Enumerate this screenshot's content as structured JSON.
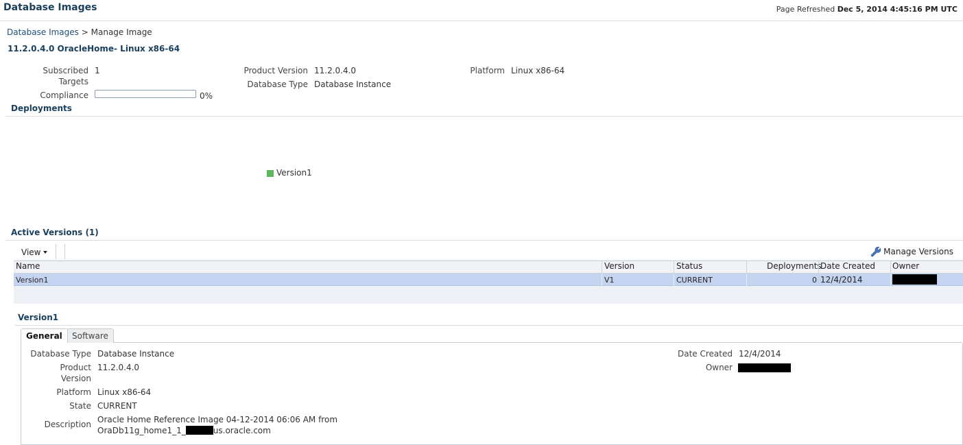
{
  "header": {
    "title": "Database Images",
    "refresh_label": "Page Refreshed",
    "refresh_time": "Dec 5, 2014 4:45:16 PM UTC"
  },
  "breadcrumb": {
    "link": "Database Images",
    "separator": ">",
    "current": "Manage Image"
  },
  "image_title": "11.2.0.4.0 OracleHome- Linux x86-64",
  "summary": {
    "subscribed_targets_label_1": "Subscribed",
    "subscribed_targets_label_2": "Targets",
    "subscribed_targets_value": "1",
    "compliance_label": "Compliance",
    "compliance_percent": 0,
    "compliance_text": "0%",
    "product_version_label": "Product Version",
    "product_version_value": "11.2.0.4.0",
    "database_type_label": "Database Type",
    "database_type_value": "Database Instance",
    "platform_label": "Platform",
    "platform_value": "Linux x86-64"
  },
  "deployments": {
    "title": "Deployments",
    "legend_label": "Version1",
    "legend_color": "#5cb85c"
  },
  "active_versions": {
    "title": "Active Versions (1)",
    "view_menu": "View",
    "manage_versions": "Manage Versions",
    "columns": [
      "Name",
      "Version",
      "Status",
      "Deployments",
      "Date Created",
      "Owner"
    ],
    "rows": [
      {
        "name": "Version1",
        "version": "V1",
        "status": "CURRENT",
        "deployments": "0",
        "date_created": "12/4/2014",
        "owner": ""
      }
    ]
  },
  "detail": {
    "title": "Version1",
    "tabs": [
      "General",
      "Software"
    ],
    "active_tab": "General",
    "database_type_label": "Database Type",
    "database_type_value": "Database Instance",
    "product_version_label_1": "Product",
    "product_version_label_2": "Version",
    "product_version_value": "11.2.0.4.0",
    "platform_label": "Platform",
    "platform_value": "Linux x86-64",
    "state_label": "State",
    "state_value": "CURRENT",
    "description_label": "Description",
    "description_line1": "Oracle Home Reference Image 04-12-2014 06:06 AM from",
    "description_line2_prefix": "OraDb11g_home1_1_",
    "description_line2_suffix": "us.oracle.com",
    "date_created_label": "Date Created",
    "date_created_value": "12/4/2014",
    "owner_label": "Owner"
  },
  "colors": {
    "title": "#1a3f5c",
    "link": "#1f4e7a",
    "selected_row": "#c4d4f0",
    "panel_bg": "#edf1f6"
  }
}
